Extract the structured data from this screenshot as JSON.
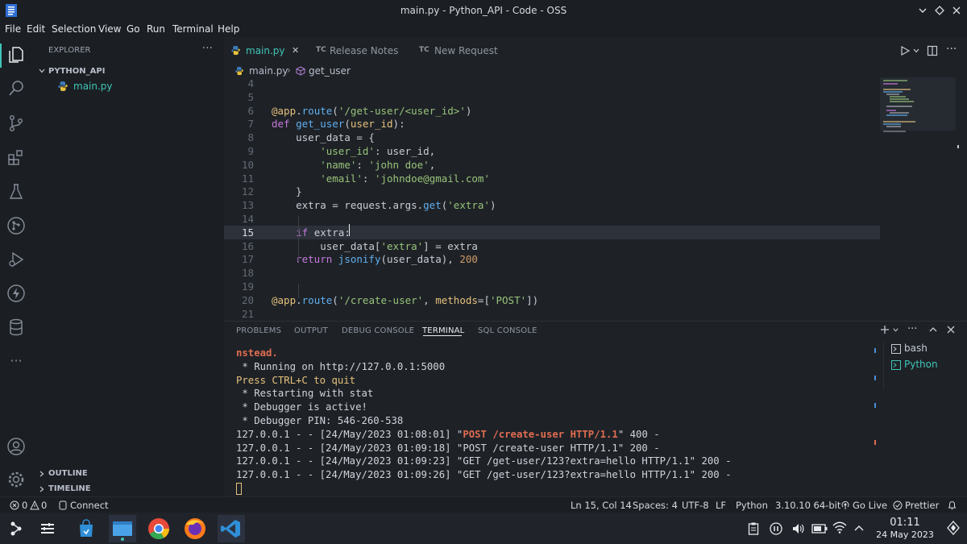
{
  "window": {
    "title": "main.py - Python_API - Code - OSS"
  },
  "menu": [
    "File",
    "Edit",
    "Selection",
    "View",
    "Go",
    "Run",
    "Terminal",
    "Help"
  ],
  "activity_icons": [
    "files-icon",
    "search-icon",
    "source-control-icon",
    "extensions-icon",
    "testing-icon",
    "git-graph-icon",
    "run-debug-icon",
    "thunder-client-icon",
    "database-icon",
    "more-icon",
    "account-icon",
    "settings-gear-icon"
  ],
  "sidebar": {
    "header": "EXPLORER",
    "more": "···",
    "folder": "PYTHON_API",
    "file": "main.py",
    "outline": "OUTLINE",
    "timeline": "TIMELINE"
  },
  "tabs": [
    {
      "label": "main.py",
      "badge": "",
      "active": true,
      "close": "✕"
    },
    {
      "label": "Release Notes",
      "badge": "TC",
      "active": false
    },
    {
      "label": "New Request",
      "badge": "TC",
      "active": false
    }
  ],
  "breadcrumb": {
    "file": "main.py",
    "symbol": "get_user"
  },
  "editor": {
    "current_line": 15,
    "lines": [
      {
        "n": "4",
        "html": ""
      },
      {
        "n": "5",
        "html": ""
      },
      {
        "n": "6",
        "html": "<span class='dec'>@app</span>.<span class='fn'>route</span>(<span class='str'>'/get-user/&lt;user_id&gt;'</span>)"
      },
      {
        "n": "7",
        "html": "<span class='kw'>def</span> <span class='fn'>get_user</span>(<span class='prm'>user_id</span>):"
      },
      {
        "n": "8",
        "html": "    user_data = {"
      },
      {
        "n": "9",
        "html": "        <span class='str'>'user_id'</span>: user_id,"
      },
      {
        "n": "10",
        "html": "        <span class='str'>'name'</span>: <span class='str'>'john doe'</span>,"
      },
      {
        "n": "11",
        "html": "        <span class='str'>'email'</span>: <span class='str'>'johndoe@gmail.com'</span>"
      },
      {
        "n": "12",
        "html": "    }"
      },
      {
        "n": "13",
        "html": "    extra = request.args.<span class='fn'>get</span>(<span class='str'>'extra'</span>)"
      },
      {
        "n": "14",
        "html": ""
      },
      {
        "n": "15",
        "html": "    <span class='kw'>if</span> extra:"
      },
      {
        "n": "16",
        "html": "        user_data[<span class='str'>'extra'</span>] = extra"
      },
      {
        "n": "17",
        "html": "    <span class='kw'>return</span> <span class='fn'>jsonify</span>(user_data), <span class='num'>200</span>"
      },
      {
        "n": "18",
        "html": ""
      },
      {
        "n": "19",
        "html": ""
      },
      {
        "n": "20",
        "html": "<span class='dec'>@app</span>.<span class='fn'>route</span>(<span class='str'>'/create-user'</span>, <span class='prm'>methods</span>=[<span class='str'>'POST'</span>])"
      },
      {
        "n": "21",
        "html": ""
      }
    ]
  },
  "panel": {
    "tabs": [
      "PROBLEMS",
      "OUTPUT",
      "DEBUG CONSOLE",
      "TERMINAL",
      "SQL CONSOLE"
    ],
    "active_tab": "TERMINAL",
    "terminal_lines": [
      {
        "html": "<span style='color:#e06c50;font-weight:bold'>nstead.</span>"
      },
      {
        "html": " * Running on http://127.0.0.1:5000"
      },
      {
        "html": "<span style='color:#e5c07b'>Press CTRL+C to quit</span>"
      },
      {
        "html": " * Restarting with stat"
      },
      {
        "html": " * Debugger is active!"
      },
      {
        "html": " * Debugger PIN: 546-260-538"
      },
      {
        "html": "127.0.0.1 - - [24/May/2023 01:08:01] \"<span style='color:#e06c50;font-weight:bold'>POST /create-user HTTP/1.1</span>\" 400 -"
      },
      {
        "html": "127.0.0.1 - - [24/May/2023 01:09:18] \"POST /create-user HTTP/1.1\" 200 -"
      },
      {
        "html": "127.0.0.1 - - [24/May/2023 01:09:23] \"GET /get-user/123?extra=hello HTTP/1.1\" 200 -"
      },
      {
        "html": "127.0.0.1 - - [24/May/2023 01:09:26] \"GET /get-user/123?extra=hello HTTP/1.1\" 200 -"
      }
    ],
    "terminals": [
      "bash",
      "Python"
    ]
  },
  "status": {
    "problems_errors": "0",
    "problems_warnings": "0",
    "connect": "Connect",
    "position": "Ln 15, Col 14",
    "spaces": "Spaces: 4",
    "encoding": "UTF-8",
    "eol": "LF",
    "language": "Python",
    "interpreter": "3.10.10 64-bit",
    "golive": "Go Live",
    "prettier": "Prettier"
  },
  "taskbar": {
    "time": "01:11",
    "date": "24 May 2023"
  },
  "colors": {
    "accent": "#3fc5b7",
    "background": "#1e2227",
    "chrome": "#1b1f23"
  }
}
